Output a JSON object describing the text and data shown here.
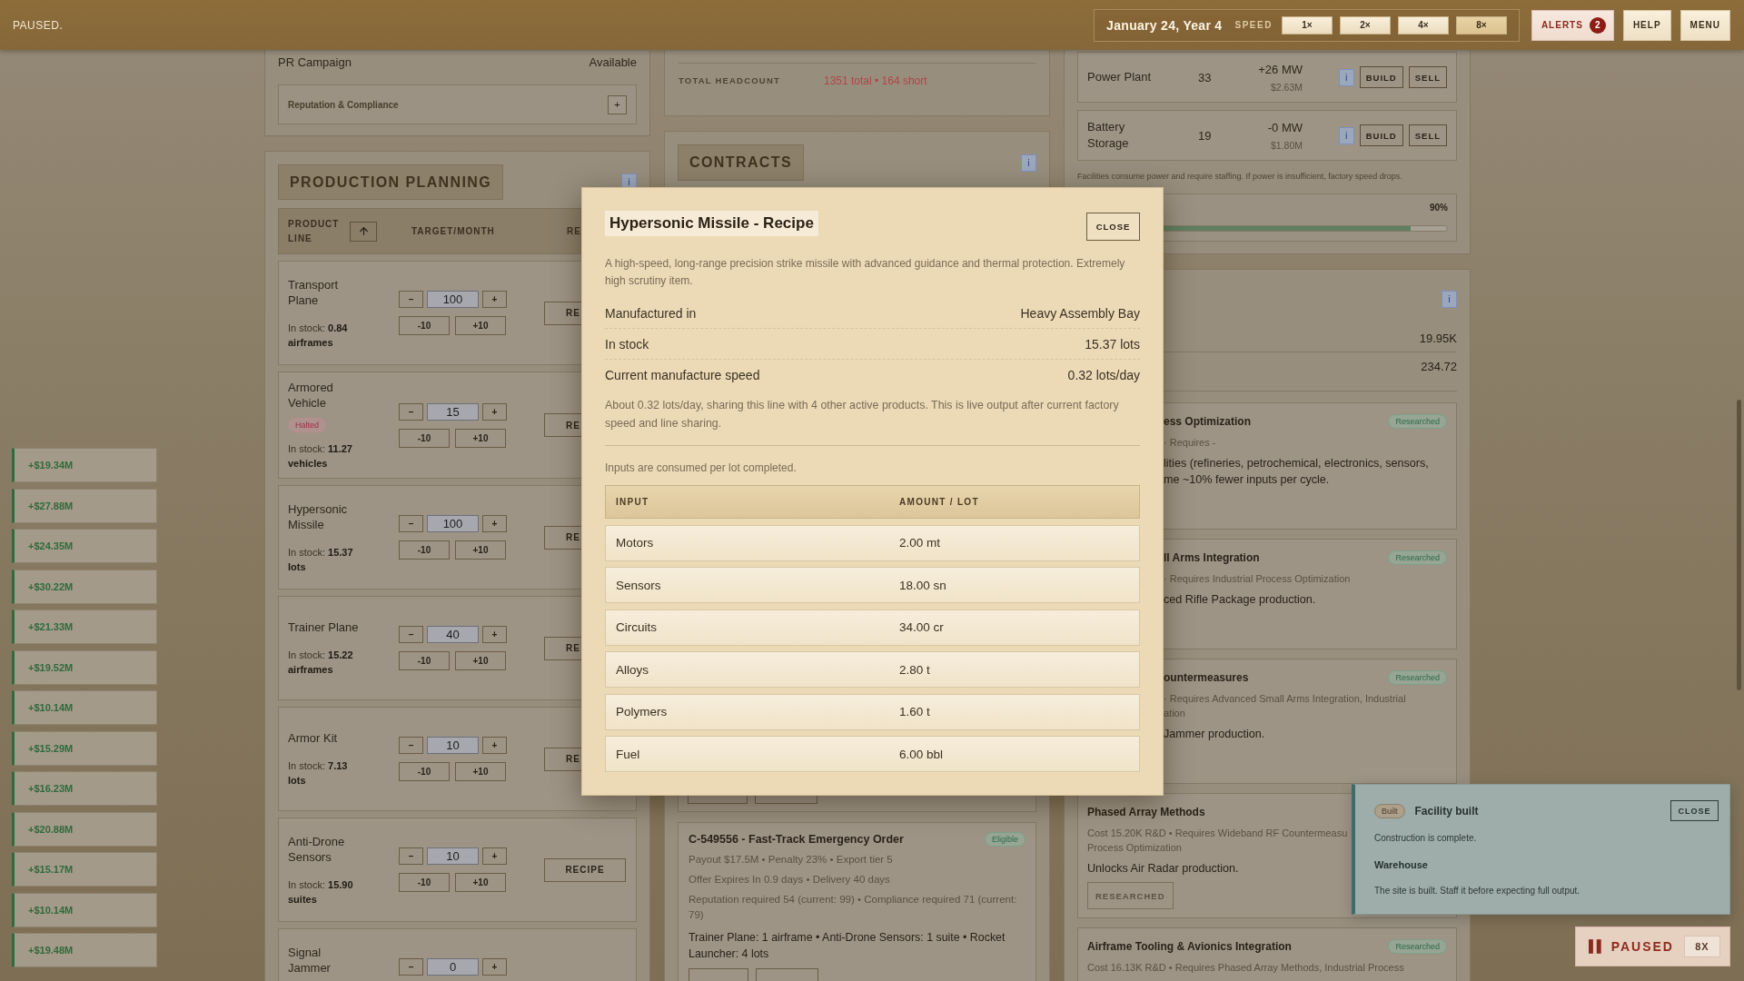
{
  "top_bar": {
    "status": "PAUSED.",
    "date": "January 24, Year 4",
    "speed_label": "SPEED",
    "speeds": [
      {
        "label": "1×",
        "selected": false
      },
      {
        "label": "2×",
        "selected": false
      },
      {
        "label": "4×",
        "selected": false
      },
      {
        "label": "8×",
        "selected": true
      }
    ],
    "alerts": {
      "label": "ALERTS",
      "count": "2"
    },
    "buttons": [
      "HELP",
      "MENU"
    ]
  },
  "income_feed": [
    "+$19.34M",
    "+$27.88M",
    "+$24.35M",
    "+$30.22M",
    "+$21.33M",
    "+$19.52M",
    "+$10.14M",
    "+$15.29M",
    "+$16.23M",
    "+$20.88M",
    "+$15.17M",
    "+$10.14M",
    "+$19.48M"
  ],
  "reputation_panel": {
    "rows": [
      {
        "label": "PR Campaign",
        "value": "Available"
      }
    ],
    "section": {
      "title": "Reputation & Compliance",
      "toggle": "+"
    }
  },
  "production_planning": {
    "title": "PRODUCTION PLANNING",
    "info": "i",
    "columns": [
      "PRODUCT LINE",
      "TARGET/MONTH",
      "RE"
    ],
    "rows": [
      {
        "name": "Transport Plane",
        "target": "100",
        "buttons": [
          "–",
          "+",
          "-10",
          "+10"
        ],
        "stock": "In stock: **0.84 airframes**",
        "recipe": {
          "label": "RE",
          "kind": "covered"
        }
      },
      {
        "name": "Armored Vehicle",
        "badge": "Halted",
        "target": "15",
        "buttons": [
          "–",
          "+",
          "-10",
          "+10"
        ],
        "stock": "In stock: **11.27 vehicles**",
        "recipe": {
          "label": "RE",
          "kind": "covered"
        }
      },
      {
        "name": "Hypersonic Missile",
        "target": "100",
        "buttons": [
          "–",
          "+",
          "-10",
          "+10"
        ],
        "stock": "In stock: **15.37 lots**",
        "recipe": {
          "label": "RE",
          "kind": "covered"
        }
      },
      {
        "name": "Trainer Plane",
        "target": "40",
        "buttons": [
          "–",
          "+",
          "-10",
          "+10"
        ],
        "stock": "In stock: **15.22 airframes**",
        "recipe": {
          "label": "RE",
          "kind": "covered"
        }
      },
      {
        "name": "Armor Kit",
        "target": "10",
        "buttons": [
          "–",
          "+",
          "-10",
          "+10"
        ],
        "stock": "In stock: **7.13 lots**",
        "recipe": {
          "label": "RE",
          "kind": "covered"
        }
      },
      {
        "name": "Anti-Drone Sensors",
        "target": "10",
        "buttons": [
          "–",
          "+",
          "-10",
          "+10"
        ],
        "stock": "In stock: **15.90 suites**",
        "recipe": {
          "label": "RECIPE",
          "kind": "full"
        }
      },
      {
        "name": "Signal Jammer",
        "target": "0",
        "buttons": [
          "–",
          "+"
        ]
      }
    ]
  },
  "headcount": {
    "label": "TOTAL HEADCOUNT",
    "value": "1351 total • 164 short"
  },
  "contracts": {
    "title": "CONTRACTS",
    "info": "i",
    "card": {
      "title": "C-549556 - Fast-Track Emergency Order",
      "badge": "Eligible",
      "details": [
        "Payout $17.5M • Penalty 23% • Export tier 5",
        "Offer Expires In 0.9 days • Delivery 40 days",
        "Reputation required 54 (current: 99) • Compliance required 71 (current: 79)"
      ],
      "items": "Trainer Plane: 1 airframe • Anti-Drone Sensors: 1 suite • Rocket Launcher: 4 lots"
    }
  },
  "facilities": {
    "rows": [
      {
        "name": "Power Plant",
        "count": "33",
        "power": "+26 MW",
        "price": "$2.63M",
        "info": "i",
        "actions": [
          "BUILD",
          "SELL"
        ]
      },
      {
        "name": "Battery Storage",
        "count": "19",
        "power": "-0 MW",
        "price": "$1.80M",
        "info": "i",
        "actions": [
          "BUILD",
          "SELL"
        ]
      }
    ],
    "note": "Facilities consume power and require staffing. If power is insufficient, factory speed drops.",
    "capacity": {
      "reading": "90%",
      "level": 0.9
    }
  },
  "research": {
    "info": "i",
    "stats": [
      "19.95K",
      "234.72"
    ],
    "cards": [
      {
        "kind": "covered",
        "title": "ess Optimization",
        "badge": "Researched",
        "requirement": "· Requires -",
        "description": "lities (refineries, petrochemical, electronics, sensors,\nme ~10% fewer inputs per cycle."
      },
      {
        "kind": "covered",
        "title": "ll Arms Integration",
        "badge": "Researched",
        "requirement": "· Requires Industrial Process Optimization",
        "description": "ced Rifle Package production."
      },
      {
        "kind": "covered",
        "title": "ountermeasures",
        "badge": "Researched",
        "requirement": "· Requires Advanced Small Arms Integration, Industrial\nation",
        "description": "Jammer production."
      },
      {
        "kind": "full",
        "title": "Phased Array Methods",
        "requirement": "Cost 15.20K R&D • Requires Wideband RF Countermeasu\nProcess Optimization",
        "description": "Unlocks Air Radar production.",
        "button": "RESEARCHED"
      },
      {
        "kind": "full",
        "title": "Airframe Tooling & Avionics Integration",
        "badge": "Researched",
        "requirement": "Cost 16.13K R&D • Requires Phased Array Methods, Industrial Process"
      }
    ]
  },
  "recipe_dialog": {
    "title": "Hypersonic Missile - Recipe",
    "close": "CLOSE",
    "description": "A high-speed, long-range precision strike missile with advanced guidance and thermal protection. Extremely high scrutiny item.",
    "facts": [
      {
        "label": "Manufactured in",
        "value": "Heavy Assembly Bay"
      },
      {
        "label": "In stock",
        "value": "15.37 lots"
      },
      {
        "label": "Current manufacture speed",
        "value": "0.32 lots/day"
      }
    ],
    "speed_note": "About 0.32 lots/day, sharing this line with 4 other active products. This is live output after current factory speed and line sharing.",
    "inputs_note": "Inputs are consumed per lot completed.",
    "table": {
      "columns": [
        "INPUT",
        "AMOUNT / LOT"
      ],
      "rows": [
        [
          "Motors",
          "2.00 mt"
        ],
        [
          "Sensors",
          "18.00 sn"
        ],
        [
          "Circuits",
          "34.00 cr"
        ],
        [
          "Alloys",
          "2.80 t"
        ],
        [
          "Polymers",
          "1.60 t"
        ],
        [
          "Fuel",
          "6.00 bbl"
        ]
      ]
    }
  },
  "notification": {
    "badge": "Built",
    "title": "Facility built",
    "close": "CLOSE",
    "message": "Construction is complete.",
    "subject": "Warehouse",
    "detail": "The site is built. Staff it before expecting full output."
  },
  "pause_indicator": {
    "label": "PAUSED",
    "speed": "8X"
  }
}
